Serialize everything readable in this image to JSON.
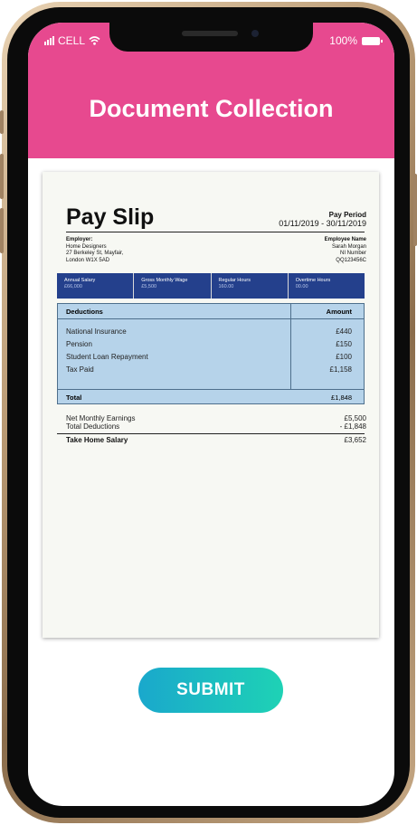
{
  "status": {
    "carrier": "CELL",
    "battery": "100%"
  },
  "header": {
    "title": "Document Collection",
    "color": "#e7498f"
  },
  "payslip": {
    "title": "Pay Slip",
    "pay_period_label": "Pay Period",
    "pay_period": "01/11/2019 - 30/11/2019",
    "employer_label": "Employer:",
    "employer_lines": [
      "Home Designers",
      "27 Berkeley St, Mayfair,",
      "London W1X 5AD"
    ],
    "employee_name_label": "Employee Name",
    "employee_name": "Sarah Morgan",
    "ni_label": "NI Number",
    "ni_number": "QQ123456C",
    "summary": [
      {
        "label": "Annual Salary",
        "value": "£66,000"
      },
      {
        "label": "Gross Monthly Wage",
        "value": "£5,500"
      },
      {
        "label": "Regular Hours",
        "value": "160.00"
      },
      {
        "label": "Overtime Hours",
        "value": "00.00"
      }
    ],
    "deductions_header": "Deductions",
    "amount_header": "Amount",
    "deductions": [
      {
        "name": "National Insurance",
        "amount": "£440"
      },
      {
        "name": "Pension",
        "amount": "£150"
      },
      {
        "name": "Student Loan Repayment",
        "amount": "£100"
      },
      {
        "name": "Tax Paid",
        "amount": "£1,158"
      }
    ],
    "total_label": "Total",
    "total_amount": "£1,848",
    "net_label": "Net Monthly Earnings",
    "net_amount": "£5,500",
    "total_deductions_label": "Total Deductions",
    "total_deductions_amount": "-  £1,848",
    "take_home_label": "Take Home Salary",
    "take_home_amount": "£3,652"
  },
  "submit": {
    "label": "SUBMIT"
  },
  "colors": {
    "accent": "#e7498f",
    "strip": "#24408c",
    "table_fill": "#b6d3ea",
    "button_start": "#1aa8cc",
    "button_end": "#1ed2b5"
  }
}
